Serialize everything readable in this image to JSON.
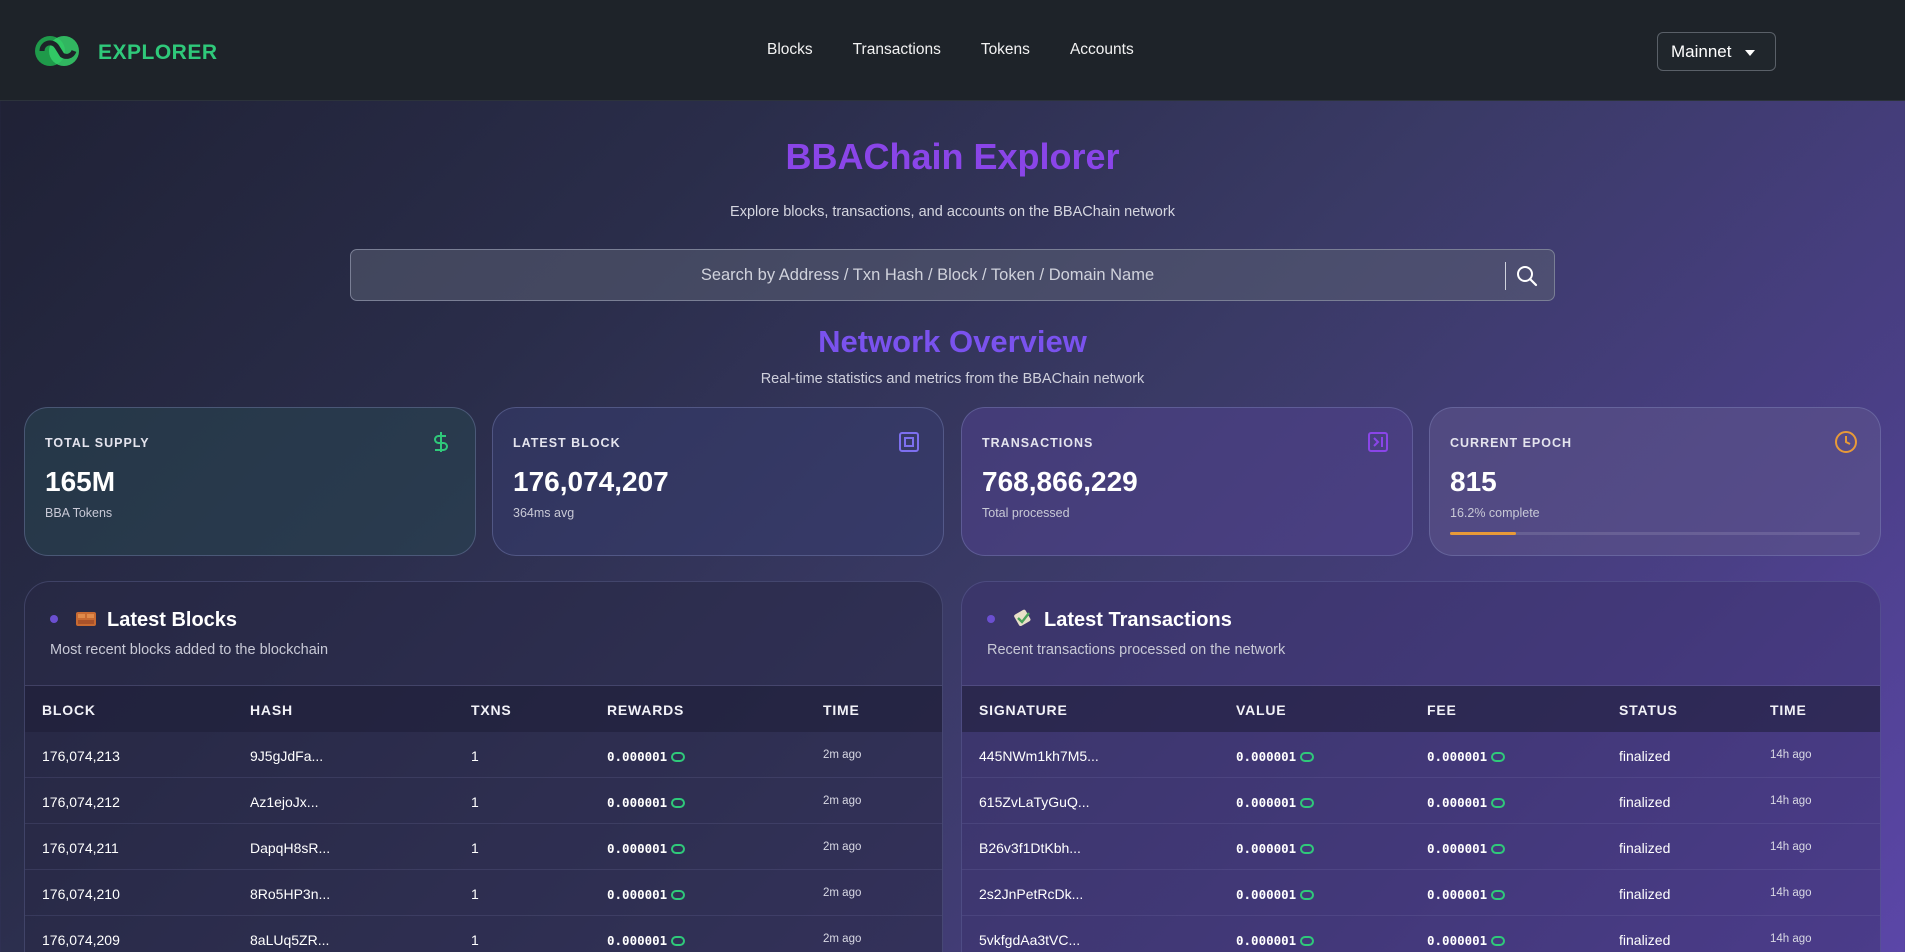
{
  "header": {
    "brand": "EXPLORER",
    "nav": [
      "Blocks",
      "Transactions",
      "Tokens",
      "Accounts"
    ],
    "network": "Mainnet"
  },
  "hero": {
    "title": "BBAChain Explorer",
    "subtitle": "Explore blocks, transactions, and accounts on the BBAChain network",
    "search_placeholder": "Search by Address / Txn Hash / Block / Token / Domain Name"
  },
  "overview": {
    "title": "Network Overview",
    "subtitle": "Real-time statistics and metrics from the BBAChain network",
    "cards": [
      {
        "label": "TOTAL SUPPLY",
        "value": "165M",
        "note": "BBA Tokens",
        "icon": "dollar-icon",
        "color": "#2fc97a"
      },
      {
        "label": "LATEST BLOCK",
        "value": "176,074,207",
        "note": "364ms avg",
        "icon": "block-icon",
        "color": "#7d6ff0"
      },
      {
        "label": "TRANSACTIONS",
        "value": "768,866,229",
        "note": "Total processed",
        "icon": "transfer-icon",
        "color": "#8a45e8"
      },
      {
        "label": "CURRENT EPOCH",
        "value": "815",
        "note": "16.2% complete",
        "icon": "clock-icon",
        "color": "#e89a38",
        "progress": 0.162
      }
    ]
  },
  "blocks": {
    "title": "Latest Blocks",
    "subtitle": "Most recent blocks added to the blockchain",
    "columns": [
      "BLOCK",
      "HASH",
      "TXNS",
      "REWARDS",
      "TIME"
    ],
    "rows": [
      {
        "block": "176,074,213",
        "hash": "9J5gJdFa...",
        "txns": "1",
        "rewards": "0.000001",
        "time": "2m ago"
      },
      {
        "block": "176,074,212",
        "hash": "Az1ejoJx...",
        "txns": "1",
        "rewards": "0.000001",
        "time": "2m ago"
      },
      {
        "block": "176,074,211",
        "hash": "DapqH8sR...",
        "txns": "1",
        "rewards": "0.000001",
        "time": "2m ago"
      },
      {
        "block": "176,074,210",
        "hash": "8Ro5HP3n...",
        "txns": "1",
        "rewards": "0.000001",
        "time": "2m ago"
      },
      {
        "block": "176,074,209",
        "hash": "8aLUq5ZR...",
        "txns": "1",
        "rewards": "0.000001",
        "time": "2m ago"
      }
    ]
  },
  "transactions": {
    "title": "Latest Transactions",
    "subtitle": "Recent transactions processed on the network",
    "columns": [
      "SIGNATURE",
      "VALUE",
      "FEE",
      "STATUS",
      "TIME"
    ],
    "rows": [
      {
        "signature": "445NWm1kh7M5...",
        "value": "0.000001",
        "fee": "0.000001",
        "status": "finalized",
        "time": "14h ago"
      },
      {
        "signature": "615ZvLaTyGuQ...",
        "value": "0.000001",
        "fee": "0.000001",
        "status": "finalized",
        "time": "14h ago"
      },
      {
        "signature": "B26v3f1DtKbh...",
        "value": "0.000001",
        "fee": "0.000001",
        "status": "finalized",
        "time": "14h ago"
      },
      {
        "signature": "2s2JnPetRcDk...",
        "value": "0.000001",
        "fee": "0.000001",
        "status": "finalized",
        "time": "14h ago"
      },
      {
        "signature": "5vkfgdAa3tVC...",
        "value": "0.000001",
        "fee": "0.000001",
        "status": "finalized",
        "time": "14h ago"
      }
    ]
  }
}
